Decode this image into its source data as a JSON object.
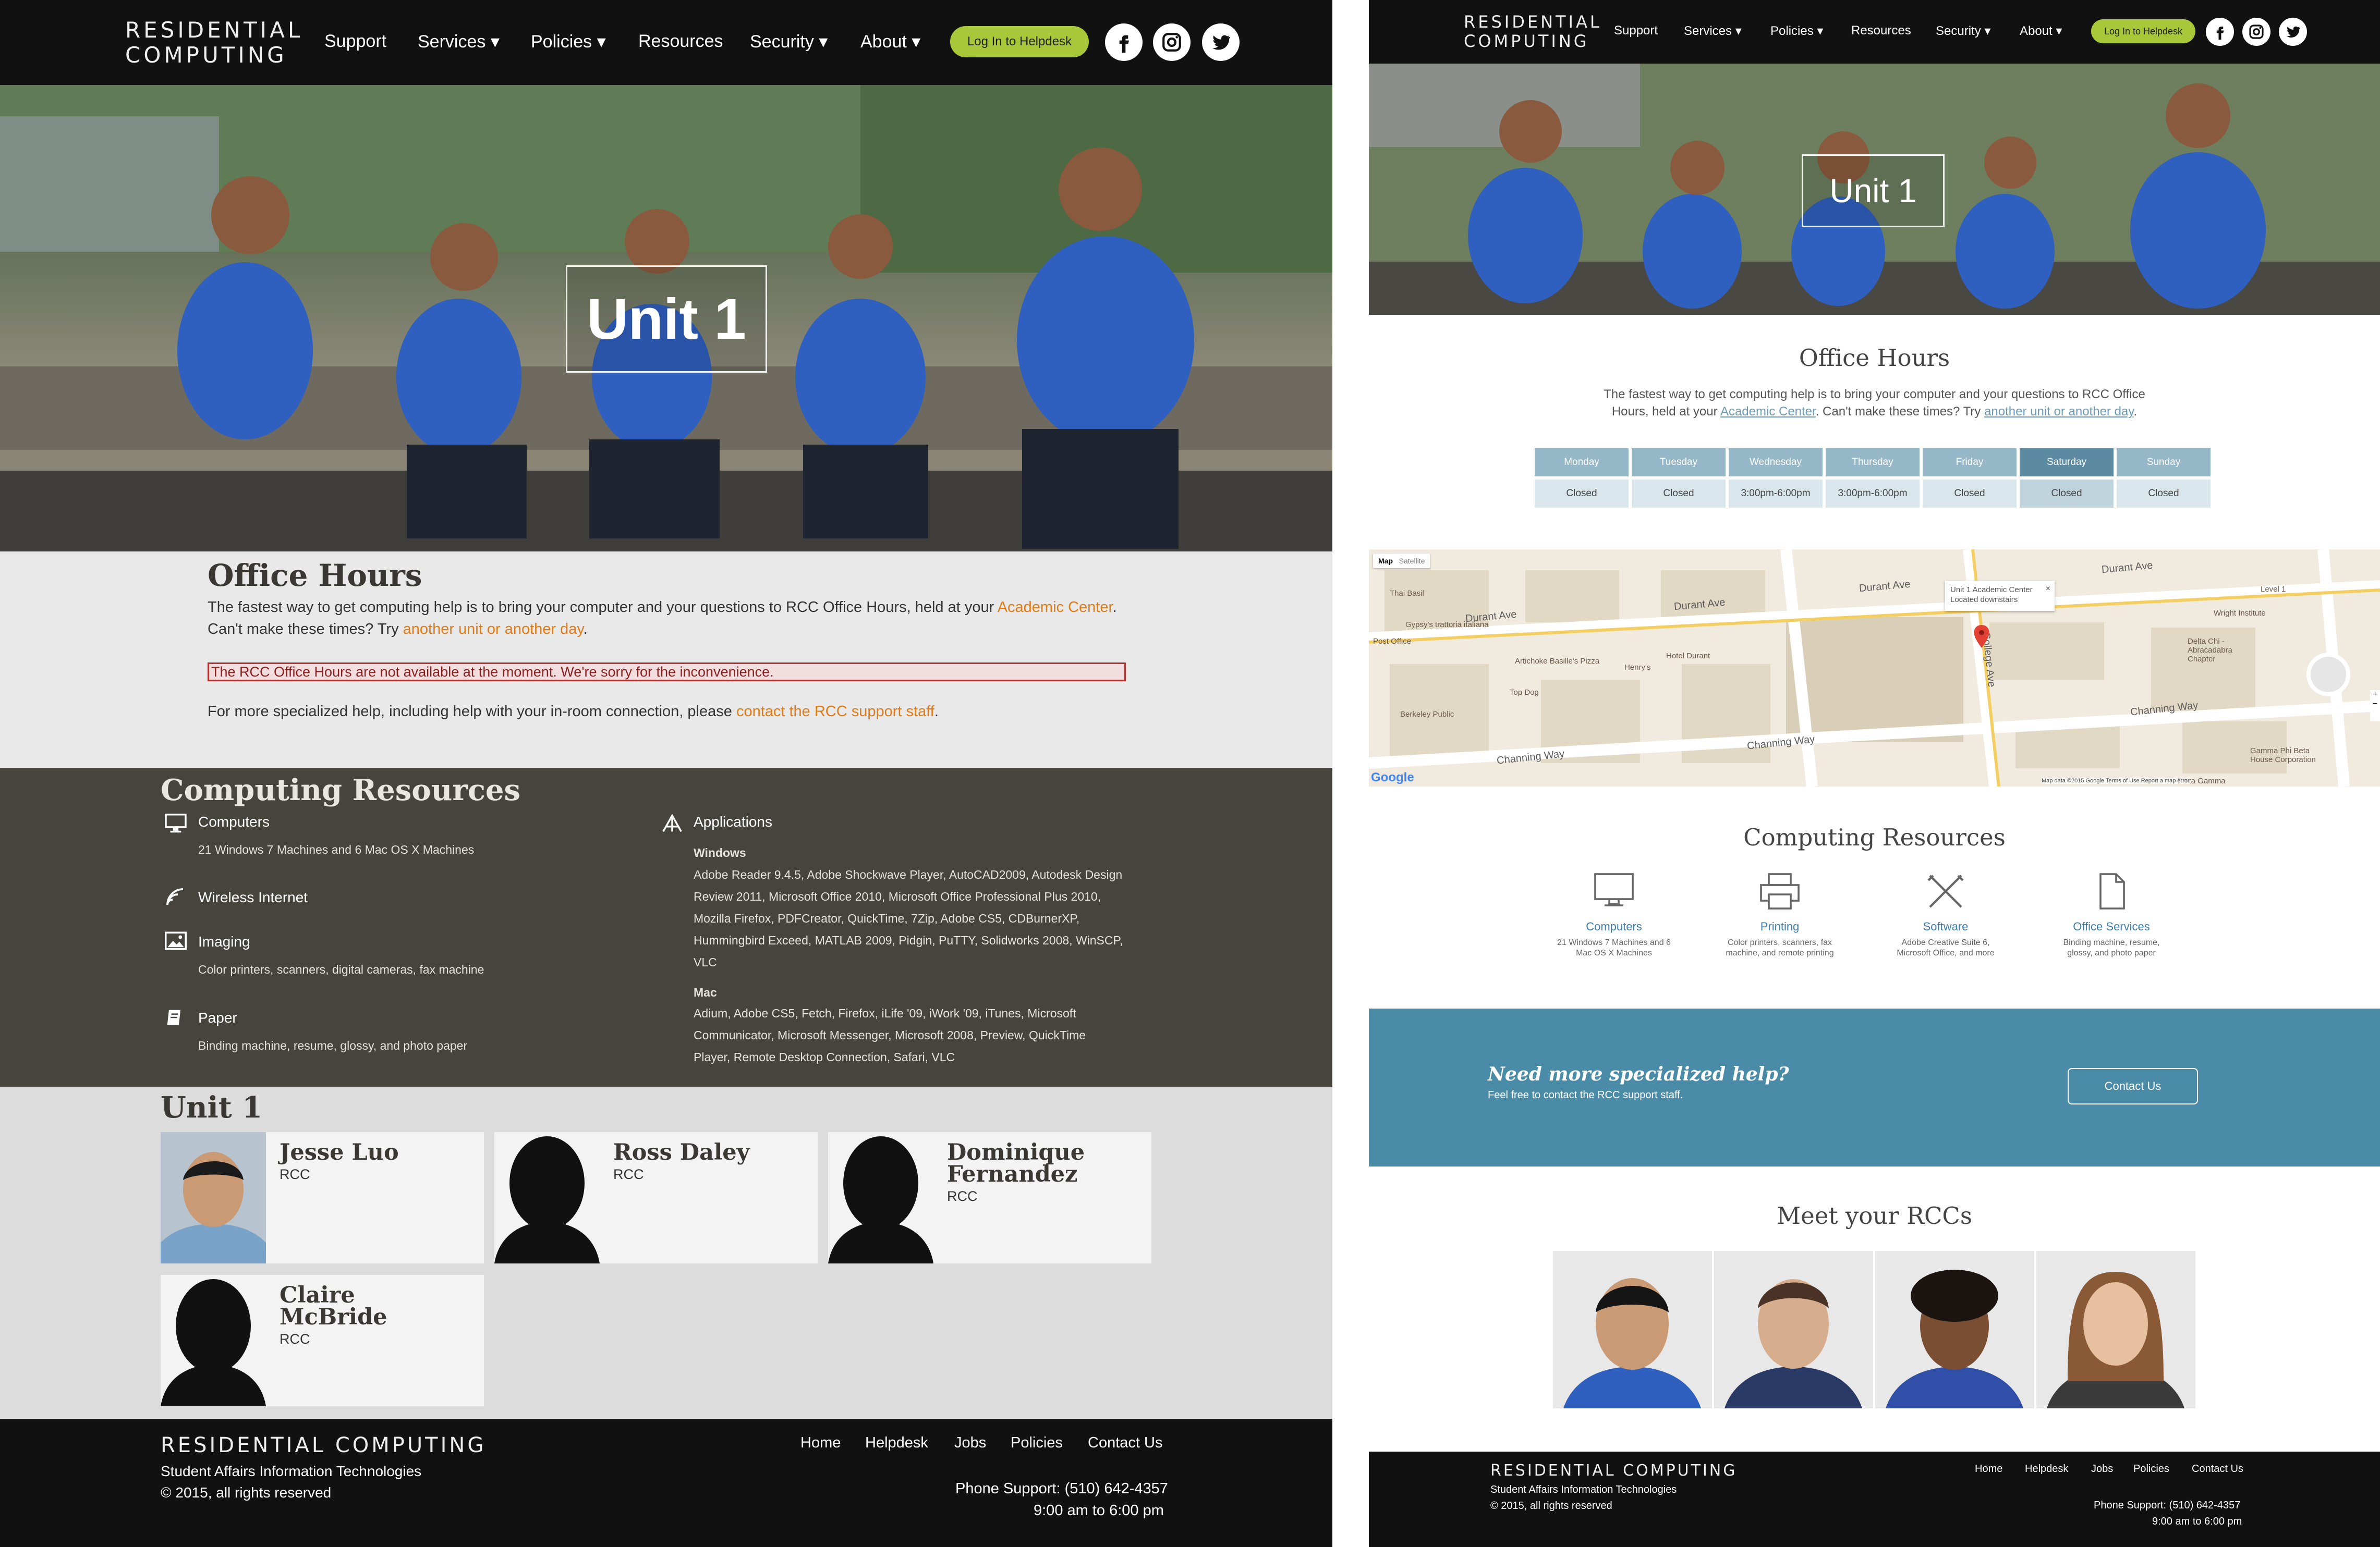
{
  "brand": {
    "line1": "RESIDENTIAL",
    "line2": "COMPUTING",
    "full": "RESIDENTIAL COMPUTING"
  },
  "nav": {
    "items": [
      "Support",
      "Services ▾",
      "Policies ▾",
      "Resources",
      "Security ▾",
      "About ▾"
    ],
    "helpdesk": "Log In to Helpdesk"
  },
  "social": [
    "facebook-icon",
    "instagram-icon",
    "twitter-icon"
  ],
  "hero": {
    "title": "Unit 1"
  },
  "office_hours": {
    "title": "Office Hours",
    "intro": "The fastest way to get computing help is to bring your computer and your questions to RCC Office Hours, held at your",
    "location_link": "Academic Center",
    "intro_end": ".",
    "cant_make": "Can't make these times? Try",
    "alt_link": "another unit or another day",
    "alt_end": ".",
    "alert": "The RCC Office Hours are not available at the moment. We're sorry for the inconvenience.",
    "specialized": "For more specialized help, including help with your in-room connection, please",
    "support_link": "contact the RCC support staff",
    "specialized_end": "."
  },
  "right_hours": {
    "title": "Office Hours",
    "line1": "The fastest way to get computing help is to bring your computer and your questions to RCC Office",
    "line2_a": "Hours, held at your",
    "line2_link": "Academic Center",
    "line2_b": ". Can't make these times? Try",
    "line2_link2": "another unit or another day",
    "line2_c": ".",
    "days": [
      "Monday",
      "Tuesday",
      "Wednesday",
      "Thursday",
      "Friday",
      "Saturday",
      "Sunday"
    ],
    "hours": [
      "Closed",
      "Closed",
      "3:00pm-6:00pm",
      "3:00pm-6:00pm",
      "Closed",
      "Closed",
      "Closed"
    ],
    "selected": "Saturday"
  },
  "computing": {
    "title": "Computing Resources",
    "computers": {
      "label": "Computers",
      "detail": "21 Windows 7 Machines and 6 Mac OS X Machines"
    },
    "wireless": {
      "label": "Wireless Internet"
    },
    "imaging": {
      "label": "Imaging",
      "detail": "Color printers, scanners, digital cameras, fax machine"
    },
    "paper": {
      "label": "Paper",
      "detail": "Binding machine, resume, glossy, and photo paper"
    },
    "apps": {
      "label": "Applications",
      "windows_label": "Windows",
      "windows": [
        "Adobe Reader 9.4.5, Adobe Shockwave Player, AutoCAD2009, Autodesk Design",
        "Review 2011, Microsoft Office 2010, Microsoft Office Professional Plus 2010,",
        "Mozilla Firefox, PDFCreator, QuickTime, 7Zip, Adobe CS5, CDBurnerXP,",
        "Hummingbird Exceed, MATLAB 2009, Pidgin, PuTTY, Solidworks 2008, WinSCP,",
        "VLC"
      ],
      "mac_label": "Mac",
      "mac": [
        "Adium, Adobe CS5, Fetch, Firefox, iLife '09, iWork '09, iTunes, Microsoft",
        "Communicator, Microsoft Messenger, Microsoft 2008, Preview, QuickTime",
        "Player, Remote Desktop Connection, Safari, VLC"
      ]
    }
  },
  "unit": {
    "title": "Unit 1",
    "people": [
      {
        "name1": "Jesse Luo",
        "name2": "",
        "role": "RCC"
      },
      {
        "name1": "Ross Daley",
        "name2": "",
        "role": "RCC"
      },
      {
        "name1": "Dominique",
        "name2": "Fernandez",
        "role": "RCC"
      },
      {
        "name1": "Claire",
        "name2": "McBride",
        "role": "RCC"
      }
    ]
  },
  "map": {
    "tabs": [
      "Map",
      "Satellite"
    ],
    "streets": [
      "Durant Ave",
      "Durant Ave",
      "Durant Ave",
      "Durant Ave",
      "Channing Way",
      "Channing Way",
      "Channing Way",
      "College Ave"
    ],
    "info": {
      "line1": "Unit 1 Academic Center",
      "line2": "Located downstairs"
    },
    "pois": [
      "Thai Basil",
      "Gypsy's trattoria italiana",
      "Post Office",
      "Artichoke Basille's Pizza",
      "Hotel Durant",
      "Henry's",
      "Top Dog",
      "Berkeley Public",
      "Level 1",
      "Wright Institute",
      "Delta Chi - Abracadabra Chapter",
      "Gamma Phi Beta House Corporation",
      "Delta Gamma"
    ],
    "google": "Google",
    "footer": "Map data ©2015 Google   Terms of Use   Report a map error"
  },
  "right_resources": {
    "title": "Computing Resources",
    "items": [
      {
        "label": "Computers",
        "sub1": "21 Windows 7 Machines and 6",
        "sub2": "Mac OS X Machines"
      },
      {
        "label": "Printing",
        "sub1": "Color printers, scanners, fax",
        "sub2": "machine, and remote printing"
      },
      {
        "label": "Software",
        "sub1": "Adobe Creative Suite 6,",
        "sub2": "Microsoft Office, and more"
      },
      {
        "label": "Office Services",
        "sub1": "Binding machine, resume,",
        "sub2": "glossy, and photo paper"
      }
    ]
  },
  "cta": {
    "title": "Need more specialized help?",
    "sub": "Feel free to contact the RCC support staff.",
    "button": "Contact Us"
  },
  "meet": {
    "title": "Meet your RCCs"
  },
  "footer": {
    "org": "Student Affairs Information Technologies",
    "copy": "© 2015, all rights reserved",
    "links": [
      "Home",
      "Helpdesk",
      "Jobs",
      "Policies",
      "Contact Us"
    ],
    "phone": "Phone Support: (510) 642-4357",
    "hours": "9:00 am to 6:00 pm"
  },
  "colors": {
    "nav": "#111111",
    "accent_green": "#a8c83a",
    "orange_link": "#e07b16",
    "dark_panel": "#47443e",
    "blue_cta": "#4a8ca8",
    "day_header": "#95b7c8",
    "day_selected": "#5c8ba1"
  }
}
